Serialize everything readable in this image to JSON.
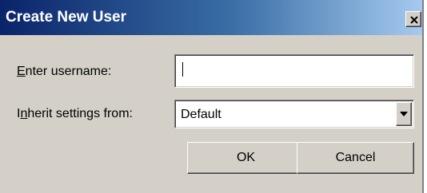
{
  "window": {
    "title": "Create New User",
    "close_icon": "close-x-icon",
    "colors": {
      "titlebar_start": "#0a246a",
      "titlebar_end": "#a6caf0",
      "dialog_bg": "#d4d0c8"
    }
  },
  "form": {
    "username": {
      "label_accel": "E",
      "label_rest": "nter username:",
      "value": ""
    },
    "inherit": {
      "label_first": "I",
      "label_accel": "n",
      "label_rest": "herit settings from:",
      "selected": "Default",
      "dropdown_icon": "chevron-down-icon"
    }
  },
  "buttons": {
    "ok": "OK",
    "cancel": "Cancel"
  }
}
